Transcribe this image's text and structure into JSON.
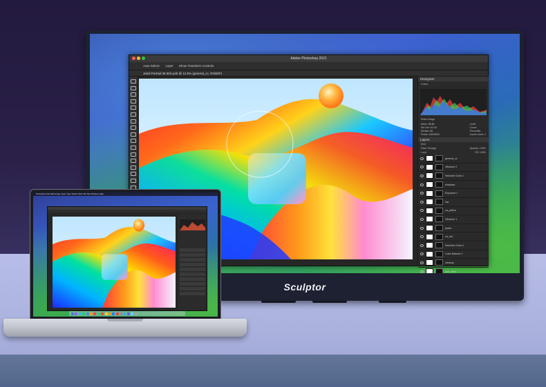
{
  "scene": {
    "monitor_brand": "Sculptor",
    "app_title": "Adobe Photoshop 2021",
    "document_tab": "Jamil Portrait 36 56X.psb @ 12.5% (general_cc, RGB/8*)",
    "options_bar": [
      "Auto-Select:",
      "Layer",
      "Show Transform Controls"
    ],
    "panels": {
      "histogram_title": "Histogram",
      "histogram_channel": "Colors",
      "histogram_source": "Entire Image",
      "histogram_stats": [
        "Mean: 88.88",
        "Std Dev: 62.04",
        "Median: 86",
        "Pixels: 23830833"
      ],
      "histogram_stats_right": [
        "Level:",
        "Count:",
        "Percentile:",
        "Cache Level: 2"
      ],
      "layers_title": "Layers",
      "layers_filter": "Kind",
      "layers_blend": "Pass Through",
      "layers_opacity": "Opacity: 100%",
      "layers_lock": "Lock:",
      "layers_fill": "Fill: 100%"
    },
    "layers": [
      "general_cc",
      "Vibrance 2",
      "Selective Color 1",
      "shadows",
      "Exposure 1",
      "hat",
      "ca_yellow",
      "Vibrance 1",
      "jacket",
      "ca_red",
      "Selective Color 2",
      "Color Balance 1",
      "cleanup",
      "skin_blem"
    ],
    "laptop_menubar": "Photoshop  File  Edit  Image  Layer  Type  Select  Filter  3D  View  Window  Help",
    "colors": {
      "background": "#2a2048",
      "desk": "#b0b7e2",
      "monitor_bezel": "#1d2131",
      "laptop_body": "#c6c9d0"
    }
  }
}
